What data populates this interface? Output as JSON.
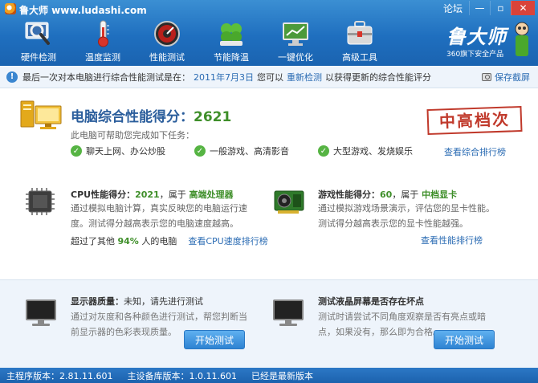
{
  "titlebar": {
    "title": "鲁大师 www.ludashi.com",
    "forum": "论坛",
    "minimize": "—",
    "restore": "▫",
    "close": "✕"
  },
  "nav": {
    "items": [
      {
        "label": "硬件检测",
        "icon": "magnifier-icon"
      },
      {
        "label": "温度监测",
        "icon": "thermometer-icon"
      },
      {
        "label": "性能测试",
        "icon": "speedometer-icon"
      },
      {
        "label": "节能降温",
        "icon": "clover-icon"
      },
      {
        "label": "一键优化",
        "icon": "monitor-icon"
      },
      {
        "label": "高级工具",
        "icon": "toolbox-icon"
      }
    ]
  },
  "brand": {
    "name": "鲁大师",
    "subtitle": "360旗下安全产品"
  },
  "infobar": {
    "prefix": "最后一次对本电脑进行综合性能测试是在：",
    "date": "2011年7月3日",
    "middle": "您可以",
    "link": "重新检测",
    "suffix": "以获得更新的综合性能评分",
    "screenshot": "保存截屏"
  },
  "overall": {
    "title": "电脑综合性能得分：",
    "score": "2621",
    "subtitle": "此电脑可帮助您完成如下任务：",
    "tasks": [
      "聊天上网、办公炒股",
      "一般游戏、高清影音",
      "大型游戏、发烧娱乐"
    ],
    "stamp": "中高档次",
    "rank_link": "查看综合排行榜"
  },
  "cpu": {
    "title": "CPU性能得分：",
    "score": "2021",
    "belongs": "，属于",
    "tag": "高端处理器",
    "desc": "通过模拟电脑计算，真实反映您的电脑运行速度。测试得分越高表示您的电脑速度越高。",
    "beat_prefix": "超过了其他",
    "beat_pct": "94%",
    "beat_suffix": "人的电脑",
    "rank_link": "查看CPU速度排行榜"
  },
  "gpu": {
    "title": "游戏性能得分：",
    "score": "60",
    "belongs": "，属于",
    "tag": "中档显卡",
    "desc": "通过模拟游戏场景演示，评估您的显卡性能。测试得分越高表示您的显卡性能越强。",
    "rank_link": "查看性能排行榜"
  },
  "display": {
    "title": "显示器质量：",
    "status": "未知，请先进行测试",
    "desc": "通过对灰度和各种颜色进行测试，帮您判断当前显示器的色彩表现质量。",
    "button": "开始测试"
  },
  "deadpixel": {
    "title": "测试液晶屏幕是否存在坏点",
    "desc": "测试时请尝试不同角度观察是否有亮点或暗点，如果没有，那么即为合格。",
    "button": "开始测试"
  },
  "status": {
    "main_version": "主程序版本：2.81.11.601",
    "db_version": "主设备库版本：1.0.11.601",
    "latest": "已经是最新版本"
  }
}
